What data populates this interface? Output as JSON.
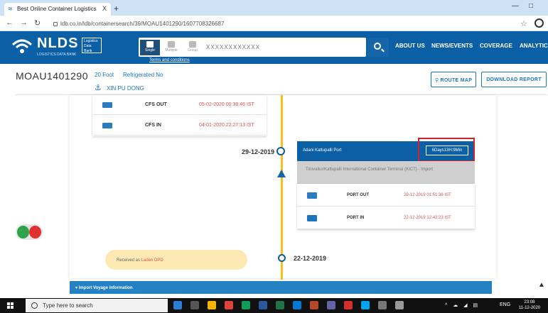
{
  "browser": {
    "tab_title": "Best Online Container Logistics",
    "tab_close": "X",
    "new_tab": "+",
    "url": "ldb.co.in/ldb/containersearch/39/MOAU1401290/1607708326687",
    "star_icon": "star-icon",
    "minimize": "—",
    "maximize": "□"
  },
  "nav": {
    "brand": "NLDS",
    "brand_sub": "LOGISTICS DATA BANK",
    "brand_box": "Logistics Data Bank",
    "modes": [
      "Single",
      "Multiple",
      "Group"
    ],
    "search_value": "XXXXXXXXXXXX",
    "terms": "Terms and conditions",
    "menu": [
      "ABOUT US",
      "NEWS/EVENTS",
      "COVERAGE",
      "ANALYTICS"
    ]
  },
  "container": {
    "id": "MOAU1401290",
    "size": "20 Foot",
    "reefer": "Refrigerated No",
    "vessel": "XIN PU DONG",
    "route_map": "ROUTE MAP",
    "download_report": "DOWNLOAD REPORT"
  },
  "cfs": [
    {
      "label": "CFS OUT",
      "date": "05-02-2020 00:38:46 IST"
    },
    {
      "label": "CFS IN",
      "date": "04-01-2020 22:27:13 IST"
    }
  ],
  "port_event": {
    "date": "29-12-2019",
    "port": "Adani Kattupalli Port",
    "duration": "6Days13H:9Min",
    "terminal": "Tiruvallur/Kattupalli International Container Terminal (KICT) - Import",
    "rows": [
      {
        "label": "PORT OUT",
        "date": "29-12-2019 01:51:36 IST"
      },
      {
        "label": "PORT IN",
        "date": "22-12-2019 12:42:23 IST"
      }
    ]
  },
  "origin": {
    "received": "Received as ",
    "received_status": "Laden DPD",
    "date": "22-12-2019"
  },
  "voyage": "▾ Import Voyage Information",
  "taskbar": {
    "search": "Type here to search",
    "lang": "ENG",
    "time": "23:08",
    "date": "11-12-2020",
    "tray": "^ ☁ ◢ ▤"
  },
  "colors": {
    "nav": "#0a5fa5",
    "accent": "#1c75bc",
    "timeline": "#f6c21a",
    "alert": "#d3212c"
  }
}
